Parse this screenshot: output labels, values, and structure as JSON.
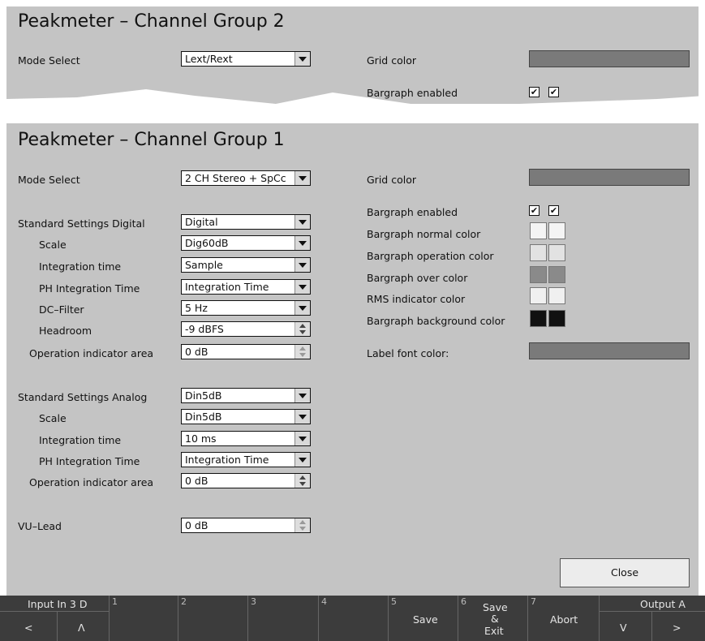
{
  "top_panel": {
    "title": "Peakmeter – Channel Group 2",
    "mode_select_label": "Mode Select",
    "mode_select_value": "Lext/Rext",
    "grid_color_label": "Grid color",
    "bargraph_enabled_label": "Bargraph enabled",
    "bargraph_checks": [
      "✔",
      "✔"
    ]
  },
  "main_panel": {
    "title": "Peakmeter – Channel Group 1",
    "mode_select_label": "Mode Select",
    "mode_select_value": "2 CH Stereo + SpCc",
    "digital": {
      "header": "Standard Settings Digital",
      "header_value": "Digital",
      "scale_label": "Scale",
      "scale_value": "Dig60dB",
      "integration_label": "Integration time",
      "integration_value": "Sample",
      "ph_label": "PH Integration Time",
      "ph_value": "Integration Time",
      "dc_label": "DC–Filter",
      "dc_value": "5 Hz",
      "headroom_label": "Headroom",
      "headroom_value": "-9 dBFS",
      "op_area_label": "Operation indicator area",
      "op_area_value": "0 dB"
    },
    "analog": {
      "header": "Standard Settings Analog",
      "header_value": "Din5dB",
      "scale_label": "Scale",
      "scale_value": "Din5dB",
      "integration_label": "Integration time",
      "integration_value": "10 ms",
      "ph_label": "PH Integration Time",
      "ph_value": "Integration Time",
      "op_area_label": "Operation indicator area",
      "op_area_value": "0 dB"
    },
    "vu_lead_label": "VU–Lead",
    "vu_lead_value": "0 dB",
    "right": {
      "grid_color_label": "Grid color",
      "bargraph_enabled_label": "Bargraph enabled",
      "bargraph_checks": [
        "✔",
        "✔"
      ],
      "normal_color_label": "Bargraph normal color",
      "operation_color_label": "Bargraph operation color",
      "over_color_label": "Bargraph over color",
      "rms_color_label": "RMS indicator color",
      "background_color_label": "Bargraph background color",
      "label_font_color_label": "Label font color:"
    },
    "colors": {
      "grid": "#7a7a7a",
      "normal": "#f4f4f4",
      "operation": "#e2e2e2",
      "over": "#8a8a8a",
      "rms": "#f0f0f0",
      "background": "#111111",
      "label_font": "#7a7a7a"
    },
    "close_label": "Close"
  },
  "footer": {
    "left_label": "Input In 3 D",
    "left_prev": "<",
    "left_up": "Λ",
    "nums": [
      "1",
      "2",
      "3",
      "4",
      "5",
      "6",
      "7"
    ],
    "save_label": "Save",
    "save_exit_label": [
      "Save",
      "&",
      "Exit"
    ],
    "abort_label": "Abort",
    "right_label": "Output A",
    "right_down": "V",
    "right_next": ">"
  }
}
